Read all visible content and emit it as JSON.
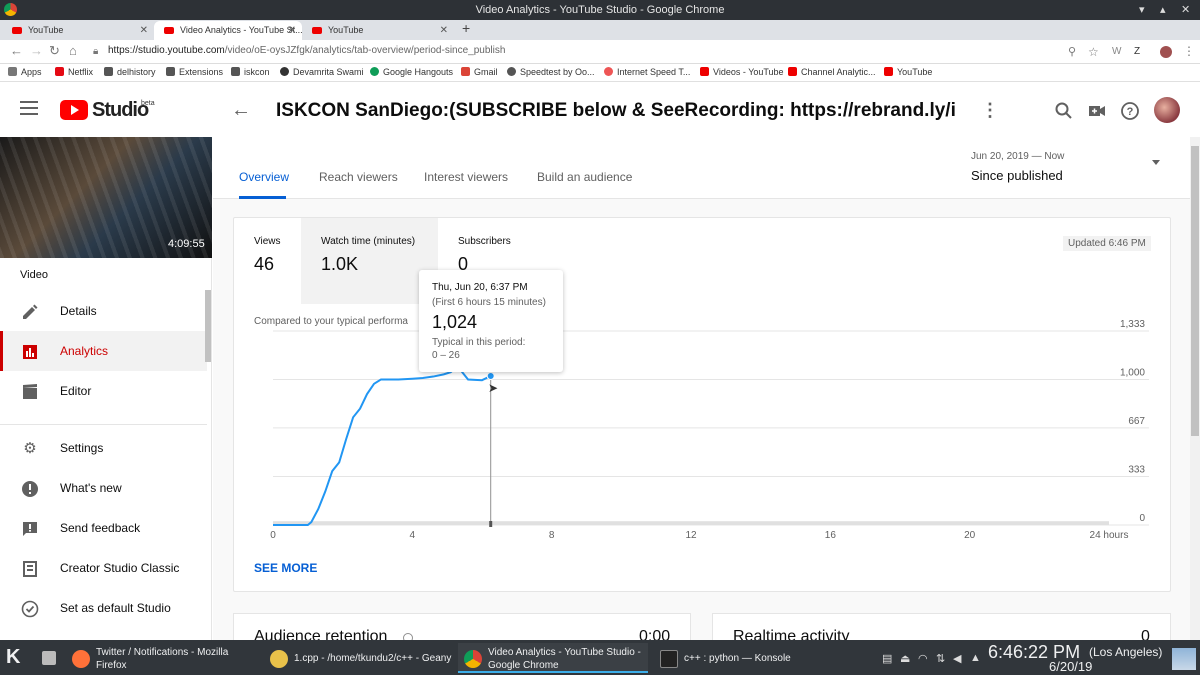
{
  "window": {
    "title": "Video Analytics - YouTube Studio - Google Chrome"
  },
  "tabs": [
    {
      "label": "YouTube"
    },
    {
      "label": "Video Analytics - YouTube St..."
    },
    {
      "label": "YouTube"
    }
  ],
  "address": {
    "url_domain": "https://studio.youtube.com",
    "url_path": "/video/oE-oysJZfgk/analytics/tab-overview/period-since_publish"
  },
  "bookmarks": [
    {
      "label": "Apps",
      "color": "#777777"
    },
    {
      "label": "Netflix",
      "color": "#e50914"
    },
    {
      "label": "delhistory",
      "color": "#555555"
    },
    {
      "label": "Extensions",
      "color": "#555555"
    },
    {
      "label": "iskcon",
      "color": "#555555"
    },
    {
      "label": "Devamrita Swami",
      "color": "#333333"
    },
    {
      "label": "Google Hangouts",
      "color": "#0f9d58"
    },
    {
      "label": "Gmail",
      "color": "#db4437"
    },
    {
      "label": "Speedtest by Oo...",
      "color": "#555555"
    },
    {
      "label": "Internet Speed T...",
      "color": "#e55"
    },
    {
      "label": "Videos - YouTube",
      "color": "#e00"
    },
    {
      "label": "Channel Analytic...",
      "color": "#e00"
    },
    {
      "label": "YouTube",
      "color": "#e00"
    }
  ],
  "studio": {
    "logo_text": "Studio",
    "beta": "beta",
    "page_title": "ISKCON SanDiego:(SUBSCRIBE below & SeeRecording: https://rebrand.ly/iskco..."
  },
  "sidebar": {
    "duration": "4:09:55",
    "section_label": "Video",
    "items": [
      {
        "label": "Details",
        "icon": "pencil-icon"
      },
      {
        "label": "Analytics",
        "icon": "analytics-icon"
      },
      {
        "label": "Editor",
        "icon": "film-icon"
      },
      {
        "label": "Settings",
        "icon": "gear-icon"
      },
      {
        "label": "What's new",
        "icon": "alert-icon"
      },
      {
        "label": "Send feedback",
        "icon": "feedback-icon"
      },
      {
        "label": "Creator Studio Classic",
        "icon": "classic-icon"
      },
      {
        "label": "Set as default Studio",
        "icon": "check-circle-icon"
      }
    ]
  },
  "analytics_tabs": [
    {
      "label": "Overview"
    },
    {
      "label": "Reach viewers"
    },
    {
      "label": "Interest viewers"
    },
    {
      "label": "Build an audience"
    }
  ],
  "period": {
    "range": "Jun 20, 2019 — Now",
    "label": "Since published"
  },
  "metrics": [
    {
      "label": "Views",
      "value": "46"
    },
    {
      "label": "Watch time (minutes)",
      "value": "1.0K"
    },
    {
      "label": "Subscribers",
      "value": "0"
    }
  ],
  "updated": "Updated 6:46 PM",
  "compared_text": "Compared to your typical performa",
  "see_more": "SEE MORE",
  "tooltip": {
    "date": "Thu, Jun 20, 6:37 PM",
    "sub": "(First 6 hours 15 minutes)",
    "value": "1,024",
    "typical_label": "Typical in this period:",
    "typical_range": "0 – 26"
  },
  "chart_data": {
    "type": "line",
    "title": "",
    "xlabel": "",
    "ylabel": "",
    "x_ticks": [
      "0",
      "4",
      "8",
      "12",
      "16",
      "20",
      "24 hours"
    ],
    "y_ticks": [
      "0",
      "333",
      "667",
      "1,000",
      "1,333"
    ],
    "xlim": [
      0,
      24
    ],
    "ylim": [
      0,
      1333
    ],
    "series": [
      {
        "color": "#2196f3",
        "x": [
          0,
          0.5,
          1,
          1.1,
          1.3,
          1.5,
          1.7,
          1.9,
          2.1,
          2.3,
          2.5,
          2.7,
          2.9,
          3.1,
          3.3,
          3.6,
          4,
          4.3,
          4.6,
          4.9,
          5.1,
          5.3,
          5.6,
          6.0,
          6.25
        ],
        "y": [
          0,
          0,
          0,
          20,
          110,
          230,
          370,
          430,
          590,
          740,
          800,
          900,
          970,
          1000,
          1000,
          1000,
          1005,
          1010,
          1020,
          1035,
          1050,
          1090,
          1000,
          995,
          1024
        ]
      }
    ],
    "typical_band": {
      "color": "#e0e0e0",
      "x": [
        0,
        24
      ],
      "low": 0,
      "high": 26
    },
    "grid": true,
    "cursor_x": 6.25
  },
  "bottom_cards": {
    "retention_title": "Audience retention",
    "retention_value": "0:00",
    "realtime_title": "Realtime activity",
    "realtime_value": "0"
  },
  "taskbar": {
    "tasks": [
      {
        "line1": "Twitter / Notifications - Mozilla",
        "line2": "Firefox",
        "color": "#ff7139"
      },
      {
        "line1": "1.cpp - /home/tkundu2/c++ - Geany",
        "line2": "",
        "color": "#e8c14a"
      },
      {
        "line1": "Video Analytics - YouTube Studio -",
        "line2": "Google Chrome",
        "color": "#4285f4"
      },
      {
        "line1": "c++ : python — Konsole",
        "line2": "",
        "color": "#222222"
      }
    ],
    "clock": "6:46:22 PM",
    "timezone": "(Los Angeles)",
    "date": "6/20/19"
  }
}
